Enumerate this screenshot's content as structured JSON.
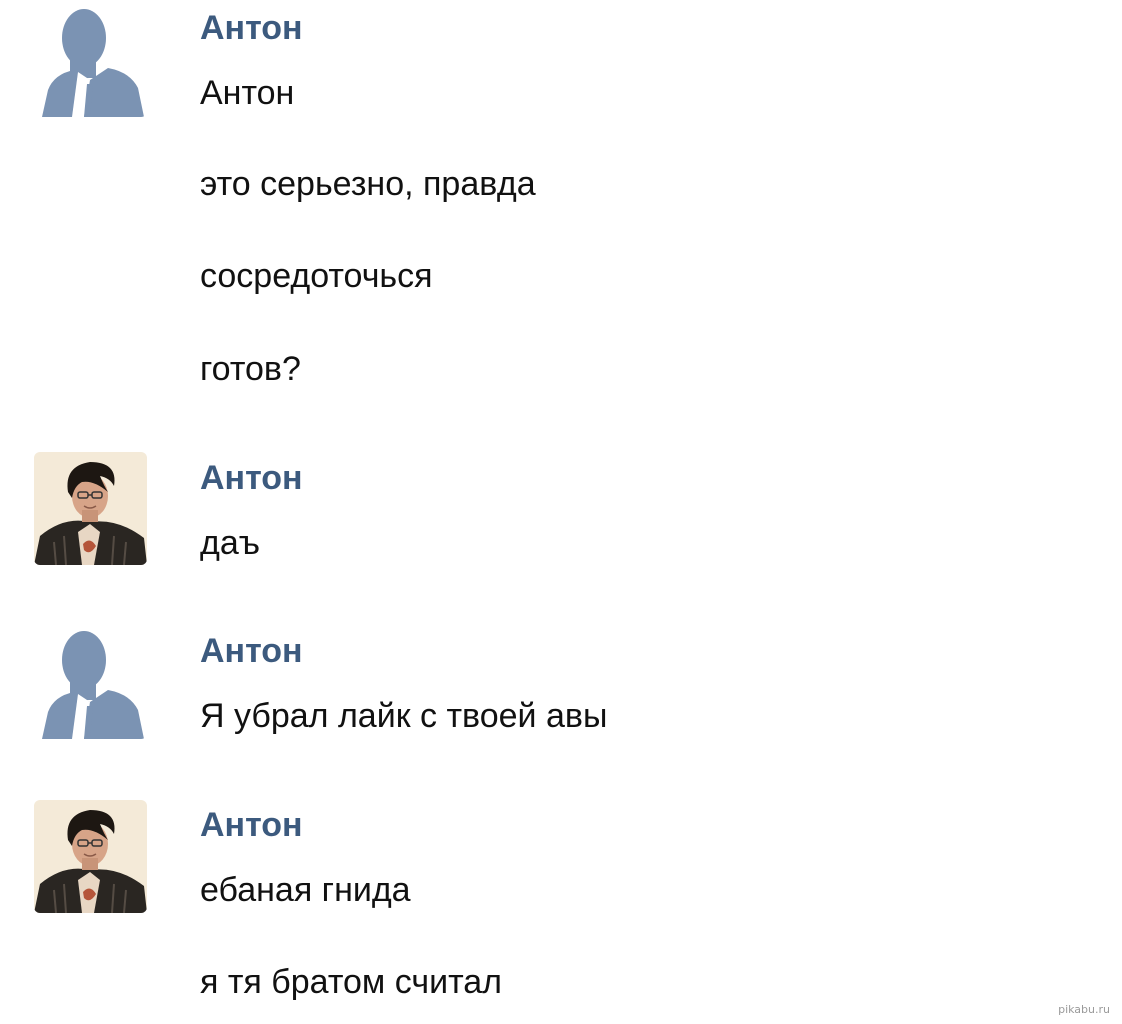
{
  "messages": [
    {
      "author": "Антон",
      "avatar": "default-silhouette-avatar",
      "lines": [
        "Антон",
        "это серьезно, правда",
        "сосредоточься",
        "готов?"
      ]
    },
    {
      "author": "Антон",
      "avatar": "photo-avatar",
      "lines": [
        "даъ"
      ]
    },
    {
      "author": "Антон",
      "avatar": "default-silhouette-avatar",
      "lines": [
        "Я убрал лайк с твоей авы"
      ]
    },
    {
      "author": "Антон",
      "avatar": "photo-avatar",
      "lines": [
        "ебаная гнида",
        "я тя братом считал"
      ]
    }
  ],
  "watermark": "pikabu.ru",
  "colors": {
    "author_name": "#3c5a7e",
    "message_text": "#111111",
    "silhouette": "#7b93b3"
  }
}
